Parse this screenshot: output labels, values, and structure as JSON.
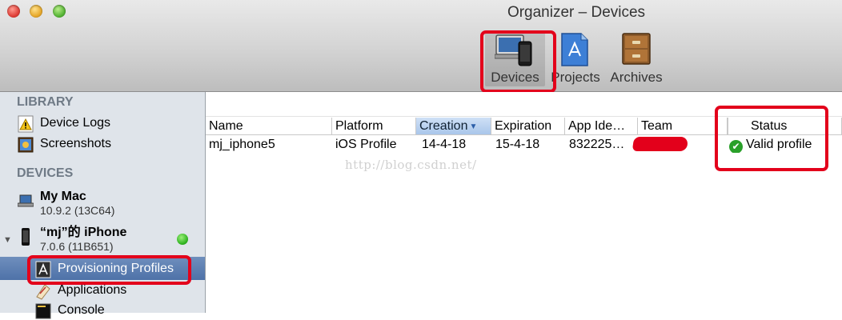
{
  "window": {
    "title": "Organizer – Devices"
  },
  "toolbar": {
    "devices_label": "Devices",
    "projects_label": "Projects",
    "archives_label": "Archives",
    "devices_icon": "devices-icon",
    "projects_icon": "projects-icon",
    "archives_icon": "archives-icon"
  },
  "sidebar": {
    "library_header": "LIBRARY",
    "library_items": [
      {
        "label": "Device Logs",
        "icon": "warning-log-icon"
      },
      {
        "label": "Screenshots",
        "icon": "screenshot-icon"
      }
    ],
    "devices_header": "DEVICES",
    "my_mac": {
      "label": "My Mac",
      "subtitle": "10.9.2 (13C64)",
      "icon": "laptop-icon"
    },
    "iphone": {
      "label": "“mj”的 iPhone",
      "subtitle": "7.0.6 (11B651)",
      "icon": "iphone-icon",
      "status_color": "#2fb320"
    },
    "iphone_items": [
      {
        "label": "Provisioning Profiles",
        "icon": "provisioning-icon",
        "selected": true
      },
      {
        "label": "Applications",
        "icon": "applications-icon"
      },
      {
        "label": "Console",
        "icon": "console-icon"
      }
    ]
  },
  "table": {
    "columns": [
      "Name",
      "Platform",
      "Creation",
      "Expiration",
      "App Ide…",
      "Team",
      "Status"
    ],
    "sorted_column": "Creation",
    "rows": [
      {
        "name": "mj_iphone5",
        "platform": "iOS Profile",
        "creation": "14-4-18",
        "expiration": "15-4-18",
        "app_id": "832225…",
        "team": "",
        "status": "Valid profile"
      }
    ]
  },
  "watermark": "http://blog.csdn.net/",
  "colors": {
    "highlight": "#e3001b",
    "selection": "#4e72a8",
    "valid": "#2aa02a"
  }
}
